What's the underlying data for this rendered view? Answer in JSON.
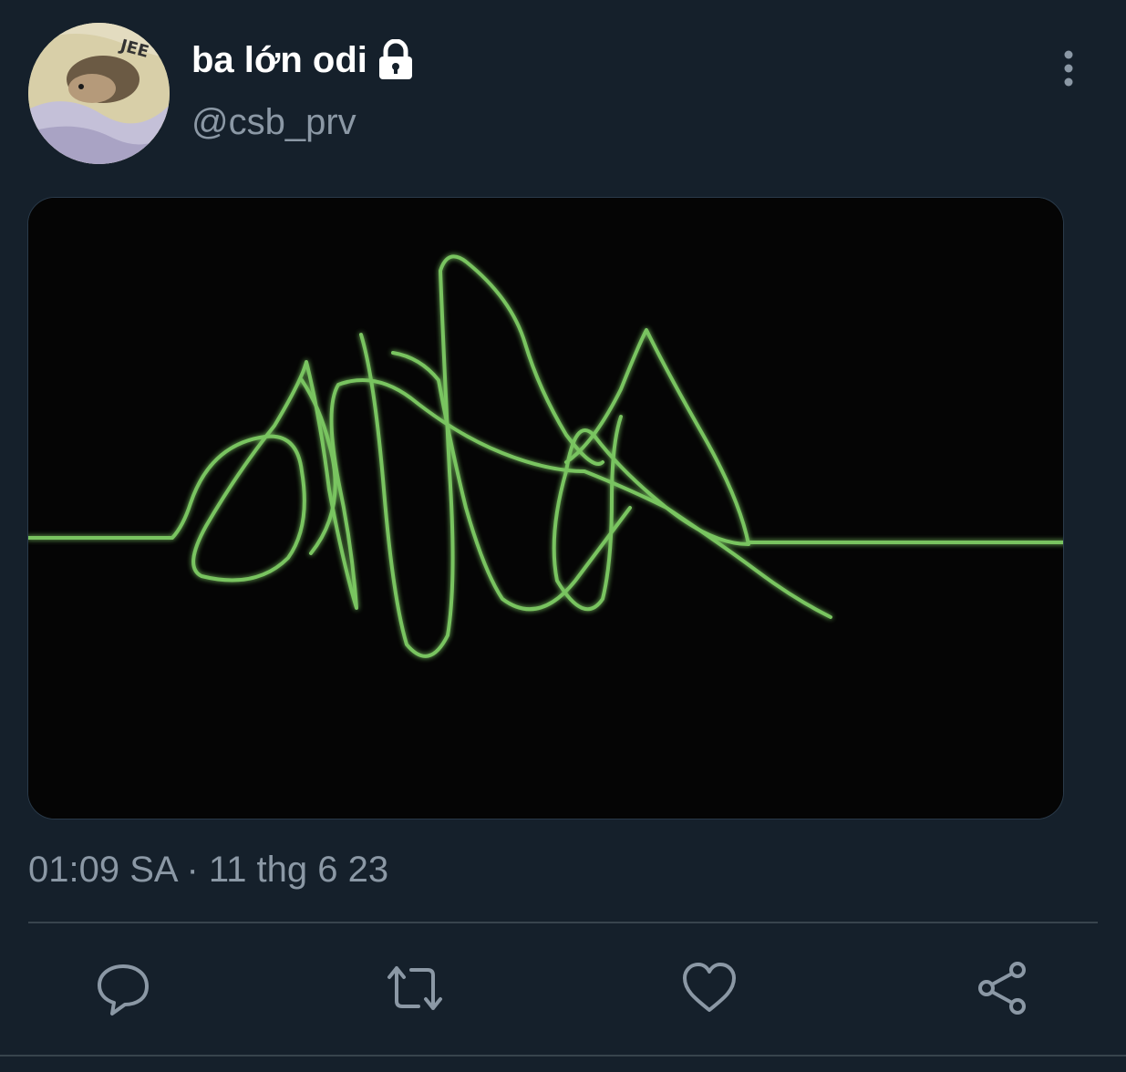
{
  "user": {
    "display_name": "ba lớn odi",
    "handle": "@csb_prv",
    "avatar_icon": "hedgehog-avatar",
    "lock_icon": "lock-icon"
  },
  "tweet": {
    "timestamp": "01:09 SA · 11 thg 6 23",
    "media_icon": "waveform-image"
  },
  "actions": {
    "reply_icon": "comment-icon",
    "retweet_icon": "retweet-icon",
    "like_icon": "heart-icon",
    "share_icon": "share-icon",
    "more_icon": "more-vertical-icon"
  },
  "colors": {
    "background": "#15202b",
    "secondary_text": "#8b98a5",
    "divider": "#38444d",
    "wave": "#7ed957"
  }
}
